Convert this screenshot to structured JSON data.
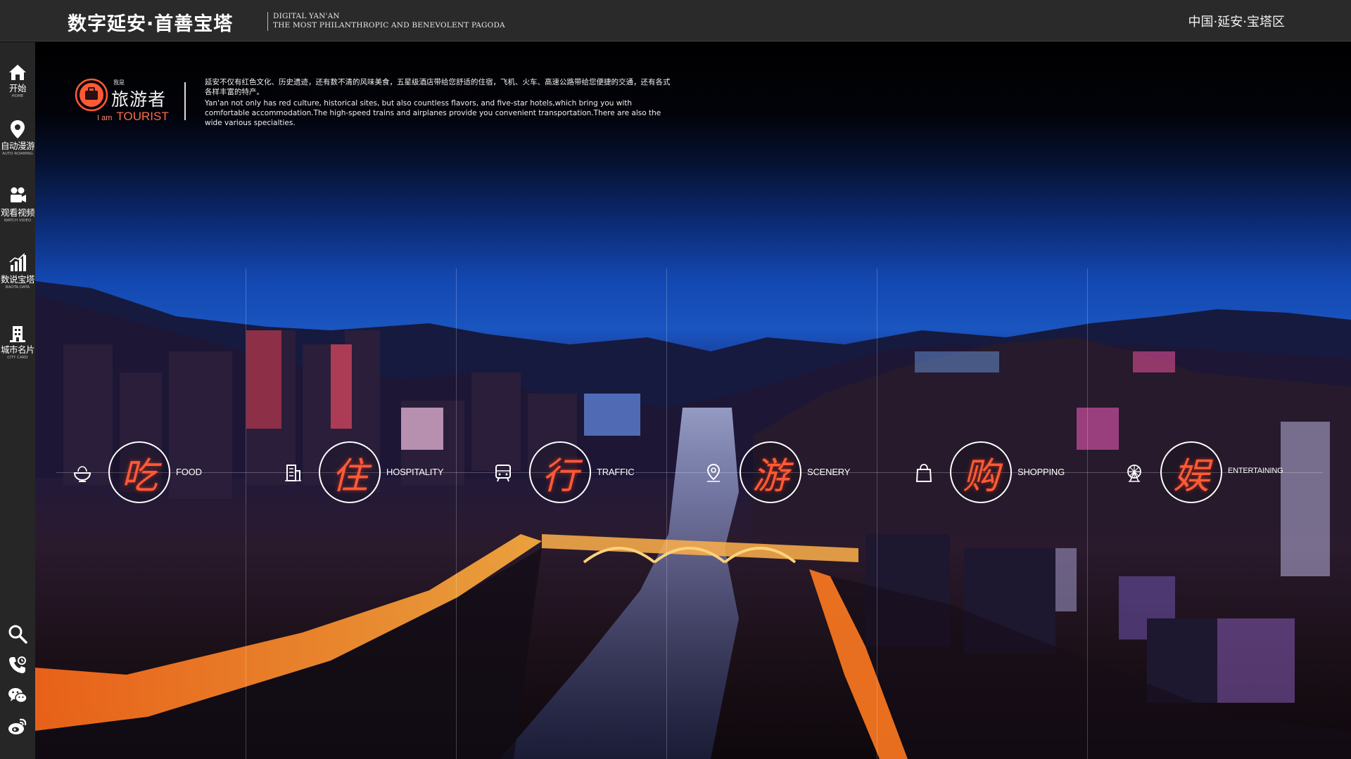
{
  "header": {
    "title_cn": "数字延安·首善宝塔",
    "subtitle_line1": "DIGITAL YAN'AN",
    "subtitle_line2": "THE MOST PHILANTHROPIC AND BENEVOLENT PAGODA",
    "region": "中国·延安·宝塔区"
  },
  "sidebar": {
    "items": [
      {
        "cn": "开始",
        "en": "HOME",
        "icon": "home-icon"
      },
      {
        "cn": "自动漫游",
        "en": "AUTO ROAMING",
        "icon": "location-pin-icon"
      },
      {
        "cn": "观看视频",
        "en": "WATCH VIDEO",
        "icon": "video-camera-icon"
      },
      {
        "cn": "数说宝塔",
        "en": "BAOTA DATA",
        "icon": "bar-chart-icon"
      },
      {
        "cn": "城市名片",
        "en": "CITY CARD",
        "icon": "building-icon"
      }
    ],
    "tools": [
      "search-icon",
      "phone-icon",
      "wechat-icon",
      "weibo-icon"
    ]
  },
  "tourist": {
    "small": "我是",
    "title_cn": "旅游者",
    "prefix_en": "I am",
    "title_en": "TOURIST",
    "intro_cn": "延安不仅有红色文化、历史遗迹，还有数不清的风味美食，五星级酒店带给您舒适的住宿，飞机、火车、高速公路带给您便捷的交通，还有各式各样丰富的特产。",
    "intro_en": "Yan'an not only has red culture, historical sites, but also countless flavors, and five-star hotels,which bring you with comfortable accommodation.The high-speed trains and airplanes provide you convenient transportation.There are also the wide various specialties."
  },
  "categories": [
    {
      "glyph": "吃",
      "label": "FOOD",
      "icon": "food-bowl-icon"
    },
    {
      "glyph": "住",
      "label": "HOSPITALITY",
      "icon": "hotel-icon"
    },
    {
      "glyph": "行",
      "label": "TRAFFIC",
      "icon": "bus-icon"
    },
    {
      "glyph": "游",
      "label": "SCENERY",
      "icon": "map-pin-icon"
    },
    {
      "glyph": "购",
      "label": "SHOPPING",
      "icon": "shopping-bag-icon"
    },
    {
      "glyph": "娱",
      "label": "ENTERTAINING",
      "icon": "ferris-wheel-icon"
    }
  ],
  "colors": {
    "accent": "#ff5a36",
    "topbar": "#2a2a2a",
    "sidebar": "#262626"
  }
}
